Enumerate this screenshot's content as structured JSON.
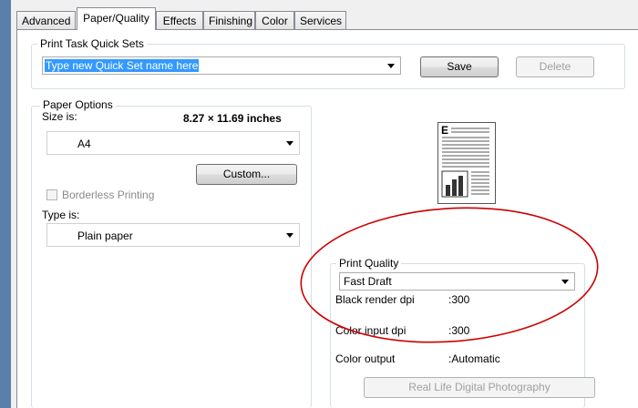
{
  "tabs": [
    {
      "label": "Advanced"
    },
    {
      "label": "Paper/Quality"
    },
    {
      "label": "Effects"
    },
    {
      "label": "Finishing"
    },
    {
      "label": "Color"
    },
    {
      "label": "Services"
    }
  ],
  "quick_sets": {
    "legend": "Print Task Quick Sets",
    "input_value": "Type new Quick Set name here",
    "save_label": "Save",
    "delete_label": "Delete"
  },
  "paper_options": {
    "legend": "Paper Options",
    "size_label": "Size is:",
    "size_dimensions": "8.27 × 11.69 inches",
    "size_value": "A4",
    "custom_label": "Custom...",
    "borderless_label": "Borderless Printing",
    "type_label": "Type is:",
    "type_value": "Plain paper"
  },
  "print_quality": {
    "legend": "Print Quality",
    "value": "Fast Draft",
    "rows": [
      {
        "label": "Black render dpi",
        "value": ":300"
      },
      {
        "label": "Color input dpi",
        "value": ":300"
      },
      {
        "label": "Color output",
        "value": ":Automatic"
      }
    ],
    "real_life_label": "Real Life Digital Photography"
  },
  "preview": {
    "letter": "E"
  },
  "colors": {
    "highlight": "#3399ff",
    "annotation": "#cc0000"
  }
}
